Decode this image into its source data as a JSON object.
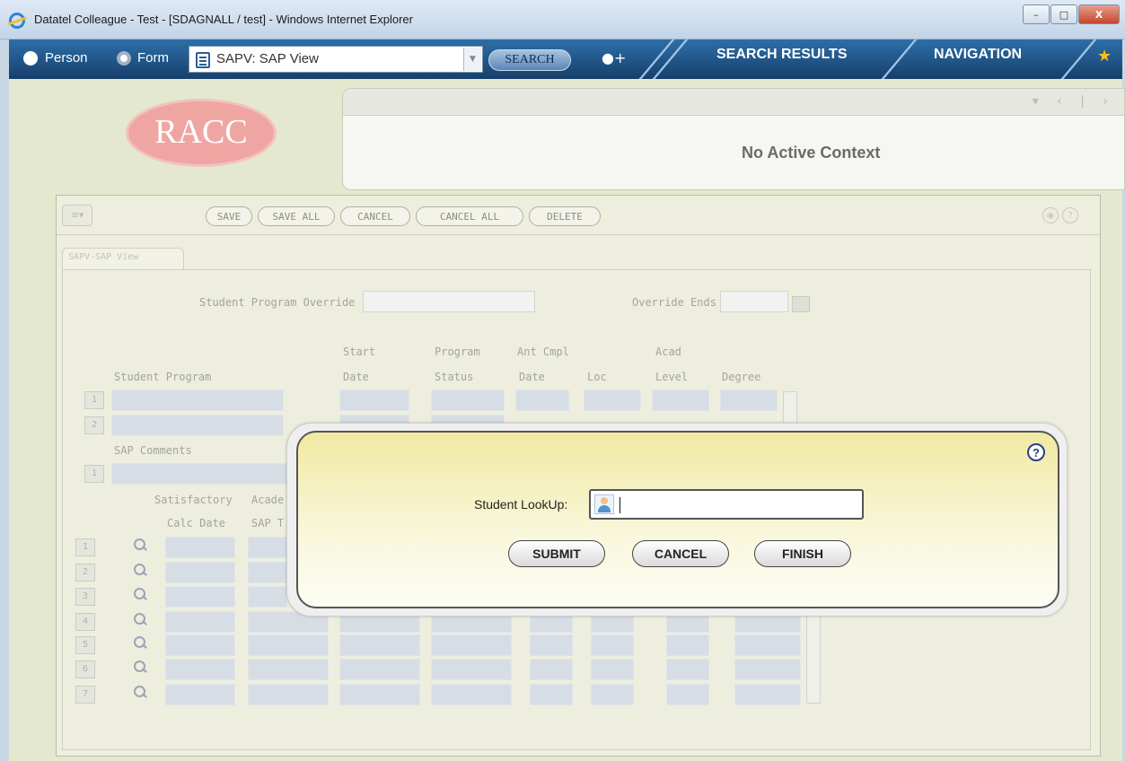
{
  "window": {
    "title": "Datatel Colleague - Test - [SDAGNALL / test] - Windows Internet Explorer",
    "minimize": "–",
    "maximize": "□",
    "close": "X"
  },
  "header": {
    "radio_person": "Person",
    "radio_form": "Form",
    "form_select_value": "SAPV: SAP View",
    "search_button": "SEARCH",
    "tab_search_results": "SEARCH RESULTS",
    "tab_navigation": "NAVIGATION"
  },
  "logo_text": "RACC",
  "context": {
    "message": "No Active Context"
  },
  "toolbar": {
    "save": "SAVE",
    "save_all": "SAVE ALL",
    "cancel": "CANCEL",
    "cancel_all": "CANCEL ALL",
    "delete": "DELETE"
  },
  "form": {
    "tab_label": "SAPV-SAP View",
    "student_program_override": "Student Program Override",
    "override_ends": "Override Ends",
    "columns": {
      "student_program": "Student Program",
      "start": "Start",
      "date": "Date",
      "program": "Program",
      "status": "Status",
      "ant_cmpl": "Ant Cmpl",
      "date2": "Date",
      "loc": "Loc",
      "acad": "Acad",
      "level": "Level",
      "degree": "Degree"
    },
    "sap_comments": "SAP Comments",
    "satisfactory": "Satisfactory",
    "calc_date": "Calc Date",
    "acade_partial": "Acade",
    "sap_t_partial": "SAP T",
    "row_numbers": [
      "1",
      "2",
      "3",
      "4",
      "5",
      "6",
      "7"
    ]
  },
  "modal": {
    "lookup_label": "Student LookUp:",
    "lookup_value": "",
    "submit": "SUBMIT",
    "cancel": "CANCEL",
    "finish": "FINISH",
    "help": "?"
  }
}
